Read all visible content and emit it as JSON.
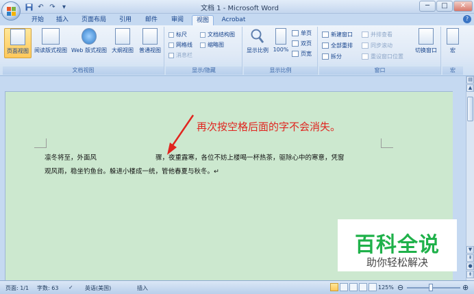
{
  "window": {
    "title": "文档 1 - Microsoft Word",
    "minimize": "─",
    "maximize": "□",
    "close": "✕"
  },
  "qat": {
    "icons": [
      "save-icon",
      "undo-icon",
      "redo-icon",
      "customize-icon"
    ]
  },
  "tabs": [
    "开始",
    "插入",
    "页面布局",
    "引用",
    "邮件",
    "审阅",
    "视图",
    "Acrobat"
  ],
  "active_tab": "视图",
  "ribbon": {
    "doc_views": {
      "label": "文档视图",
      "buttons": [
        "页面视图",
        "阅读版式视图",
        "Web 版式视图",
        "大纲视图",
        "普通视图"
      ],
      "active": "页面视图"
    },
    "show_hide": {
      "label": "显示/隐藏",
      "items": [
        {
          "text": "标尺",
          "enabled": true
        },
        {
          "text": "网格线",
          "enabled": true
        },
        {
          "text": "消息栏",
          "enabled": false
        },
        {
          "text": "文档结构图",
          "enabled": true
        },
        {
          "text": "缩略图",
          "enabled": true
        }
      ]
    },
    "zoom": {
      "label": "显示比例",
      "zoom_button": "显示比例",
      "percent_button": "100%",
      "options": [
        "单页",
        "双页",
        "页宽"
      ]
    },
    "window": {
      "label": "窗口",
      "left": [
        "新建窗口",
        "全部重排",
        "拆分"
      ],
      "right": [
        "并排查看",
        "同步滚动",
        "重设窗口位置"
      ],
      "switch": "切换窗口"
    },
    "macro": {
      "label": "宏",
      "button": "宏"
    }
  },
  "document": {
    "line1_part1": "凛冬将至，外面风",
    "line1_part2": "骤，夜重露寒，各位不妨上楼喝一杯热茶，驱除心中的寒意，凭窗",
    "line2": "观风雨，稳坐钓鱼台。躲进小楼成一统，管他春夏与秋冬。↵",
    "annotation": "再次按空格后面的字不会消失。"
  },
  "watermark": {
    "title": "百科全说",
    "subtitle": "助你轻松解决"
  },
  "status": {
    "page": "页面: 1/1",
    "words": "字数: 63",
    "language": "英语(美国)",
    "mode": "插入",
    "zoom": "125%"
  },
  "colors": {
    "page_bg": "#cce8cf",
    "annotation": "#e0251f",
    "watermark_green": "#1fb14a",
    "ribbon_active": "#ffc85a"
  }
}
